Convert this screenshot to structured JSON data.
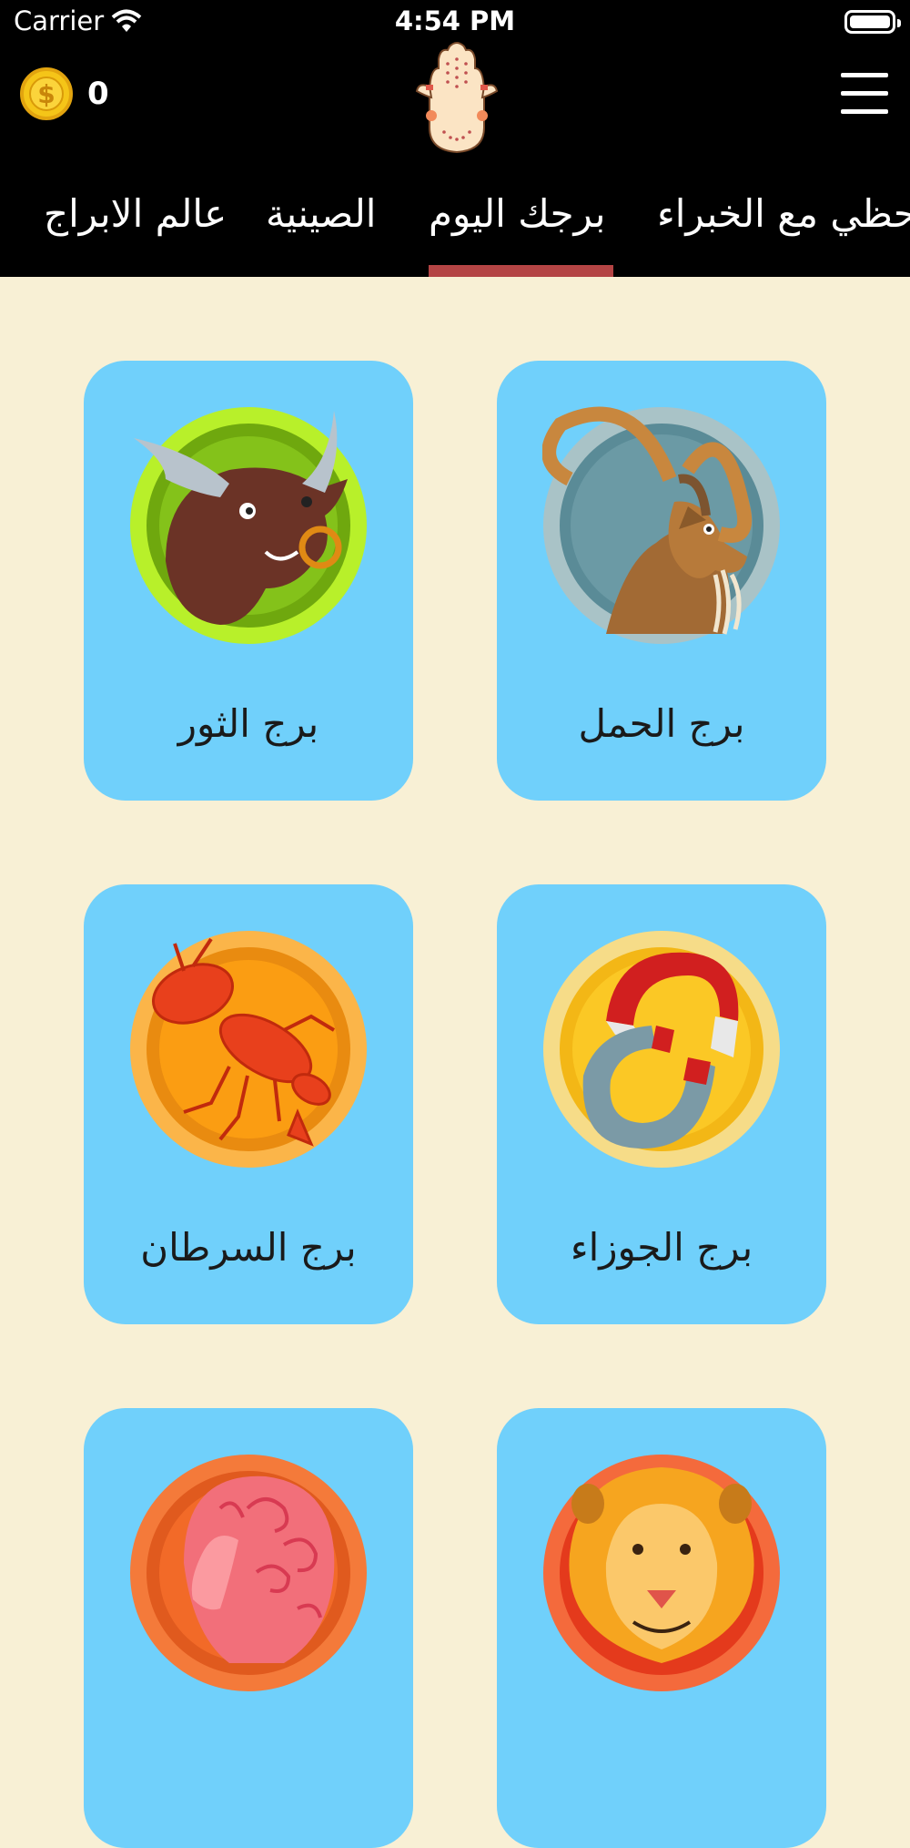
{
  "status_bar": {
    "carrier": "Carrier",
    "time": "4:54 PM"
  },
  "header": {
    "coin_count": "0"
  },
  "tabs": [
    {
      "label": "حظي مع الخبراء",
      "active": false
    },
    {
      "label": "برجك اليوم",
      "active": true
    },
    {
      "label": "الصينية",
      "active": false
    },
    {
      "label": "عالم الابراج",
      "active": false
    }
  ],
  "cards": [
    {
      "label": "برج الحمل",
      "icon": "ram-icon"
    },
    {
      "label": "برج الثور",
      "icon": "bull-icon"
    },
    {
      "label": "برج الجوزاء",
      "icon": "magnet-icon"
    },
    {
      "label": "برج السرطان",
      "icon": "lobster-icon"
    },
    {
      "label": "",
      "icon": "lion-icon"
    },
    {
      "label": "",
      "icon": "woman-head-icon"
    }
  ],
  "colors": {
    "background": "#f8f0d5",
    "card": "#70d0fb",
    "tab_indicator": "#b44444",
    "header": "#000000"
  }
}
